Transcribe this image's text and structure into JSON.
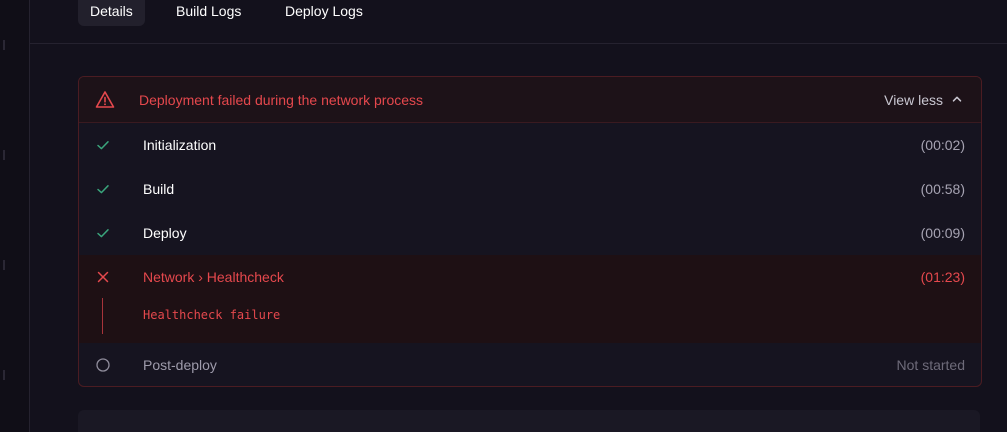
{
  "tabs": [
    {
      "label": "Details",
      "active": true
    },
    {
      "label": "Build Logs",
      "active": false
    },
    {
      "label": "Deploy Logs",
      "active": false
    }
  ],
  "alert": {
    "icon": "warning-triangle-icon",
    "message": "Deployment failed during the network process",
    "toggle_label": "View less",
    "toggle_icon": "chevron-up-icon"
  },
  "steps": [
    {
      "label": "Initialization",
      "time": "(00:02)",
      "status": "success",
      "icon": "check-icon"
    },
    {
      "label": "Build",
      "time": "(00:58)",
      "status": "success",
      "icon": "check-icon"
    },
    {
      "label": "Deploy",
      "time": "(00:09)",
      "status": "success",
      "icon": "check-icon"
    },
    {
      "label": "Network › Healthcheck",
      "time": "(01:23)",
      "status": "failed",
      "icon": "x-icon",
      "log": "Healthcheck failure"
    },
    {
      "label": "Post-deploy",
      "time": "Not started",
      "status": "pending",
      "icon": "circle-icon"
    }
  ],
  "colors": {
    "background": "#13111c",
    "error": "#e5484d",
    "success": "#3aa57c",
    "pending": "#8f8c9b"
  }
}
